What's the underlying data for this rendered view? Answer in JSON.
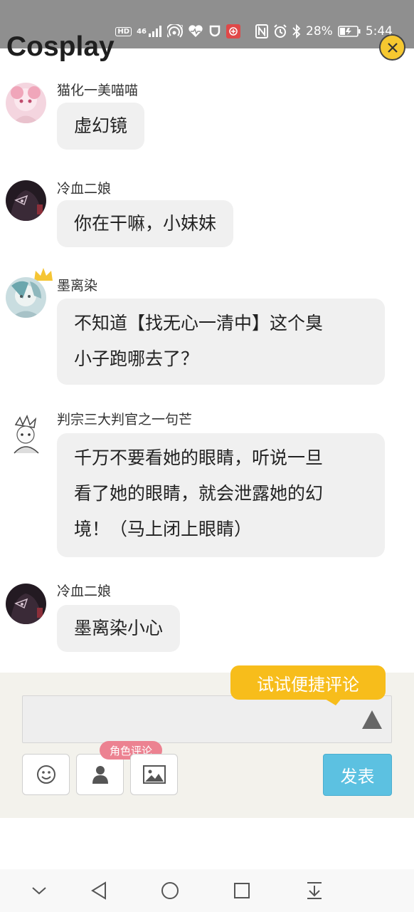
{
  "status_bar": {
    "hd": "HD",
    "network": "46",
    "battery_percent": "28%",
    "time": "5:44",
    "icons": [
      "hd-icon",
      "signal-icon",
      "hotspot-icon",
      "health-icon",
      "shield-icon",
      "app-badge-icon",
      "nfc-icon",
      "alarm-icon",
      "bluetooth-icon",
      "battery-icon"
    ]
  },
  "header": {
    "title": "Cosplay",
    "close_icon": "close-icon"
  },
  "messages": [
    {
      "username": "猫化一美喵喵",
      "lines": [
        "虚幻镜"
      ],
      "avatar_color": "#f2c9d6"
    },
    {
      "username": "冷血二娘",
      "lines": [
        "你在干嘛，小妹妹"
      ],
      "avatar_color": "#2b1f2a"
    },
    {
      "username": "墨离染",
      "lines": [
        "不知道【找无心一清中】这个臭",
        "小子跑哪去了？"
      ],
      "avatar_color": "#b9d2d6",
      "crown": true
    },
    {
      "username": "判宗三大判官之一句芒",
      "lines": [
        "千万不要看她的眼睛，听说一旦",
        "看了她的眼睛，就会泄露她的幻",
        "境！（马上闭上眼睛）"
      ],
      "avatar_color": "#efefef"
    },
    {
      "username": "冷血二娘",
      "lines": [
        "墨离染小心"
      ],
      "avatar_color": "#2b1f2a"
    }
  ],
  "composer": {
    "input_value": "",
    "tooltip": "试试便捷评论",
    "role_tag": "角色评论",
    "publish_label": "发表",
    "tools": [
      "emoji-icon",
      "role-icon",
      "image-icon"
    ]
  },
  "colors": {
    "accent_yellow": "#f7bd1b",
    "publish_blue": "#5cc1e1",
    "role_pink": "#ec8291",
    "bubble_gray": "#f0f0f0"
  },
  "nav": [
    "chevron-down-icon",
    "back-icon",
    "home-icon",
    "recents-icon",
    "download-icon"
  ]
}
